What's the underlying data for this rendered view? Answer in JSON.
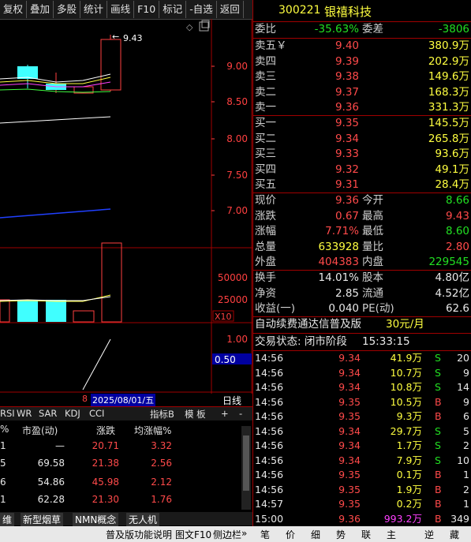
{
  "toolbar": [
    "复权",
    "叠加",
    "多股",
    "统计",
    "画线",
    "F10",
    "标记",
    "-自选",
    "返回"
  ],
  "stock": {
    "code": "300221",
    "name": "银禧科技"
  },
  "weibi": {
    "label": "委比",
    "value": "-35.63%",
    "label2": "委差",
    "value2": "-3806"
  },
  "asks": [
    {
      "label": "卖五￥",
      "price": "9.40",
      "vol": "380.9万"
    },
    {
      "label": "卖四",
      "price": "9.39",
      "vol": "202.9万"
    },
    {
      "label": "卖三",
      "price": "9.38",
      "vol": "149.6万"
    },
    {
      "label": "卖二",
      "price": "9.37",
      "vol": "168.3万"
    },
    {
      "label": "卖一",
      "price": "9.36",
      "vol": "331.3万"
    }
  ],
  "bids": [
    {
      "label": "买一",
      "price": "9.35",
      "vol": "145.5万"
    },
    {
      "label": "买二",
      "price": "9.34",
      "vol": "265.8万"
    },
    {
      "label": "买三",
      "price": "9.33",
      "vol": "93.6万"
    },
    {
      "label": "买四",
      "price": "9.32",
      "vol": "49.1万"
    },
    {
      "label": "买五",
      "price": "9.31",
      "vol": "28.4万"
    }
  ],
  "quote": [
    {
      "l1": "现价",
      "v1": "9.36",
      "l2": "今开",
      "v2": "8.66",
      "c1": "red",
      "c2": "green"
    },
    {
      "l1": "涨跌",
      "v1": "0.67",
      "l2": "最高",
      "v2": "9.43",
      "c1": "red",
      "c2": "red"
    },
    {
      "l1": "涨幅",
      "v1": "7.71%",
      "l2": "最低",
      "v2": "8.60",
      "c1": "red",
      "c2": "green"
    },
    {
      "l1": "总量",
      "v1": "633928",
      "l2": "量比",
      "v2": "2.80",
      "c1": "yellow",
      "c2": "red"
    },
    {
      "l1": "外盘",
      "v1": "404383",
      "l2": "内盘",
      "v2": "229545",
      "c1": "red",
      "c2": "green"
    }
  ],
  "fund": [
    {
      "l1": "换手",
      "v1": "14.01%",
      "l2": "股本",
      "v2": "4.80亿"
    },
    {
      "l1": "净资",
      "v1": "2.85",
      "l2": "流通",
      "v2": "4.52亿"
    },
    {
      "l1": "收益(一)",
      "v1": "0.040",
      "l2": "PE(动)",
      "v2": "62.6"
    }
  ],
  "promo": {
    "text": "自动续费通达信普及版",
    "price": "30元/月"
  },
  "trade_status": {
    "label": "交易状态: 闭市阶段",
    "time": "15:33:15"
  },
  "ticks": [
    {
      "t": "14:56",
      "p": "9.34",
      "v": "41.9万",
      "d": "S",
      "n": "20"
    },
    {
      "t": "14:56",
      "p": "9.34",
      "v": "10.7万",
      "d": "S",
      "n": "9"
    },
    {
      "t": "14:56",
      "p": "9.34",
      "v": "10.8万",
      "d": "S",
      "n": "14"
    },
    {
      "t": "14:56",
      "p": "9.35",
      "v": "10.5万",
      "d": "B",
      "n": "9"
    },
    {
      "t": "14:56",
      "p": "9.35",
      "v": "9.3万",
      "d": "B",
      "n": "6"
    },
    {
      "t": "14:56",
      "p": "9.34",
      "v": "29.7万",
      "d": "S",
      "n": "5"
    },
    {
      "t": "14:56",
      "p": "9.34",
      "v": "1.7万",
      "d": "S",
      "n": "2"
    },
    {
      "t": "14:56",
      "p": "9.34",
      "v": "7.9万",
      "d": "S",
      "n": "10"
    },
    {
      "t": "14:56",
      "p": "9.35",
      "v": "0.1万",
      "d": "B",
      "n": "1"
    },
    {
      "t": "14:56",
      "p": "9.35",
      "v": "1.9万",
      "d": "B",
      "n": "2"
    },
    {
      "t": "14:57",
      "p": "9.35",
      "v": "0.2万",
      "d": "B",
      "n": "1"
    },
    {
      "t": "15:00",
      "p": "9.36",
      "v": "993.2万",
      "d": "B",
      "n": "349"
    }
  ],
  "right_tabs": [
    "笔",
    "价",
    "细",
    "势",
    "联",
    "主",
    "逆",
    "藏"
  ],
  "chart": {
    "price_axis": [
      "9.00",
      "8.50",
      "8.00",
      "7.50",
      "7.00"
    ],
    "high_label": "9.43",
    "vol_axis": [
      "50000",
      "25000"
    ],
    "vol_unit": "X10",
    "ind_axis": [
      "1.00",
      "0.50"
    ],
    "date": "2025/08/01/五",
    "date_left": "8",
    "period": "日线"
  },
  "ind_tabs": [
    "RSI",
    "WR",
    "SAR",
    "KDJ",
    "CCI",
    "指标B",
    "模 板",
    "+",
    "-"
  ],
  "table": {
    "headers": [
      "%",
      "市盈(动)",
      "涨跌",
      "均涨幅%"
    ],
    "rows": [
      [
        "1",
        "—",
        "20.71",
        "3.32"
      ],
      [
        "5",
        "69.58",
        "21.38",
        "2.56"
      ],
      [
        "6",
        "54.86",
        "45.98",
        "2.12"
      ],
      [
        "1",
        "62.28",
        "21.30",
        "1.76"
      ]
    ]
  },
  "bottom_tabs": [
    "维",
    "新型烟草",
    "NMN概念",
    "无人机"
  ],
  "status_bar": {
    "text": "普及版功能说明",
    "f10": "图文F10",
    "side": "侧边栏",
    "arrow": "»"
  }
}
